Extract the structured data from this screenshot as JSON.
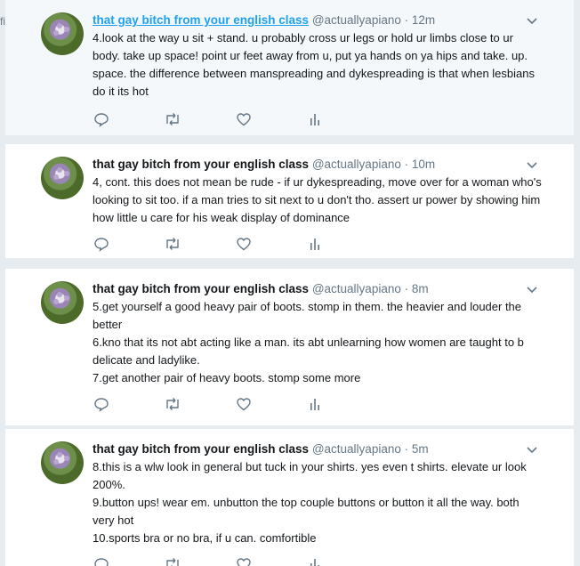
{
  "page": {
    "edge_fragment": "fi"
  },
  "tweets": [
    {
      "name": "that gay bitch from your english class",
      "handle": "@actuallyapiano",
      "dot": "·",
      "time": "12m",
      "lines": [
        "4.look at the way u sit + stand. u probably cross ur legs or hold ur limbs close to ur body. take up space! point ur feet away from u, put ya hands on ya hips and take. up. space. the difference between manspreading and dykespreading is that when lesbians do it its hot"
      ]
    },
    {
      "name": "that gay bitch from your english class",
      "handle": "@actuallyapiano",
      "dot": "·",
      "time": "10m",
      "lines": [
        "4, cont. this does not mean be rude - if ur dykespreading, move over for a woman who's looking to sit too. if a man tries to sit next to u don't tho. assert ur power by showing him how little u care for his weak display of dominance"
      ]
    },
    {
      "name": "that gay bitch from your english class",
      "handle": "@actuallyapiano",
      "dot": "·",
      "time": "8m",
      "lines": [
        "5.get yourself a good heavy pair of boots. stomp in them. the heavier and louder the better",
        "6.kno that its not abt acting like a man. its abt unlearning how women are taught to b delicate and ladylike.",
        "7.get another pair of heavy boots. stomp some more"
      ]
    },
    {
      "name": "that gay bitch from your english class",
      "handle": "@actuallyapiano",
      "dot": "·",
      "time": "5m",
      "lines": [
        "8.this is a wlw look in general but tuck in your shirts. yes even t shirts. elevate ur look 200%.",
        "9.button ups! wear em. unbutton the top couple buttons or button it all the way. both very hot",
        "10.sports bra or no bra, if u can. comfortible"
      ]
    }
  ],
  "icons": {
    "reply": "reply-icon",
    "retweet": "retweet-icon",
    "like": "heart-icon",
    "analytics": "analytics-icon",
    "menu": "chevron-down-icon"
  },
  "colors": {
    "link": "#1da1f2",
    "muted": "#657786",
    "text": "#14171a",
    "bg": "#e6ecf0"
  }
}
